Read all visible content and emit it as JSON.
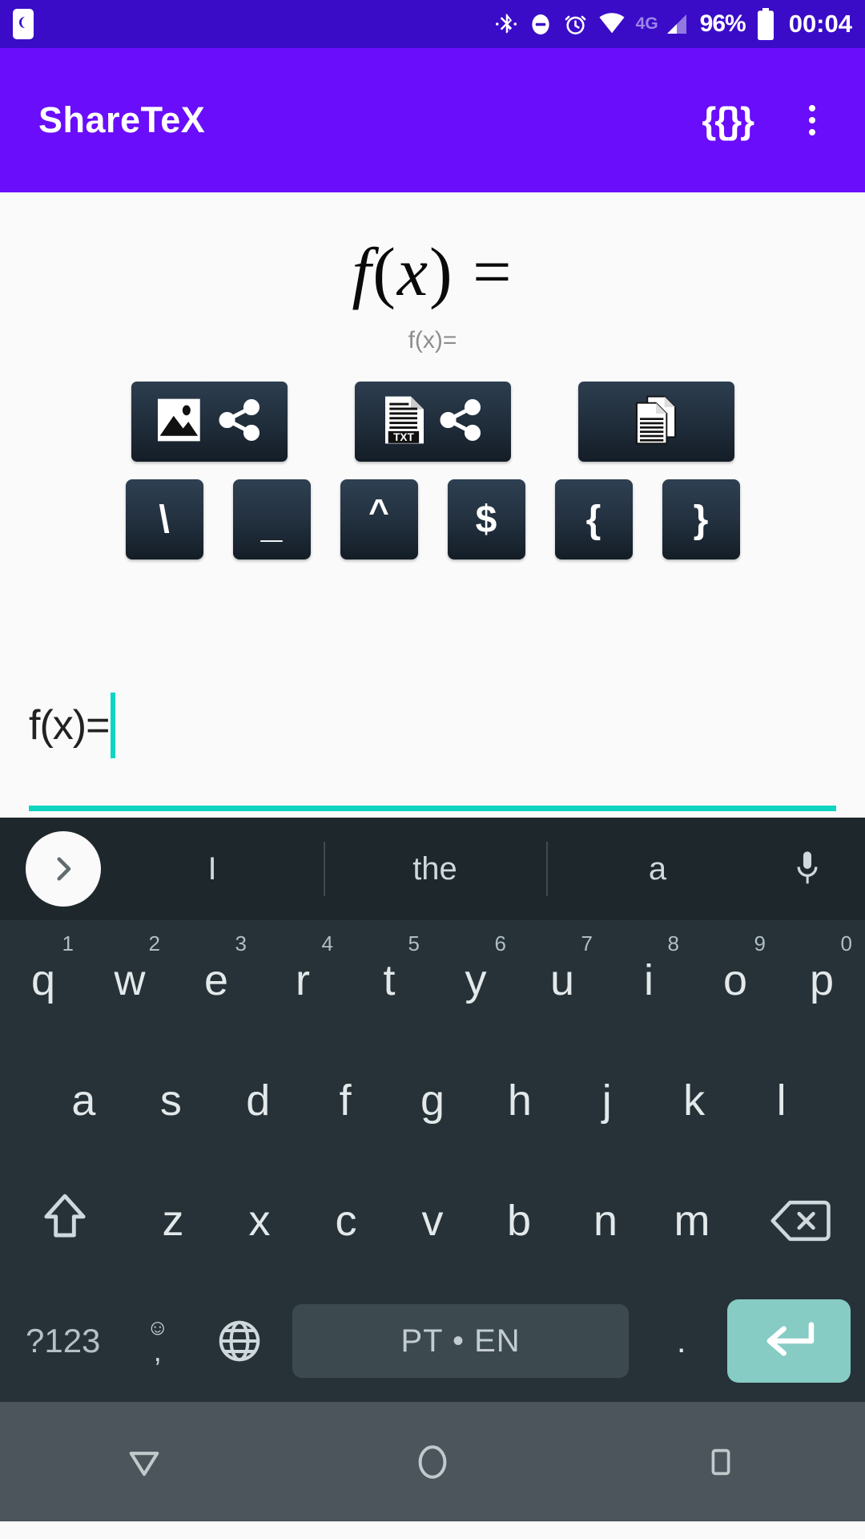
{
  "status_bar": {
    "left_icons": [
      "sim-card-icon"
    ],
    "right_icons": [
      "bluetooth-icon",
      "do-not-disturb-icon",
      "alarm-icon",
      "wifi-icon"
    ],
    "network_label": "4G",
    "battery_percent": "96%",
    "clock": "00:04",
    "background_color": "#3a0cc8"
  },
  "app_bar": {
    "title": "ShareTeX",
    "braces_action": "{{}}",
    "overflow_icon": "more-vertical-icon",
    "background_color": "#6a0dfa"
  },
  "preview": {
    "rendered_parts": {
      "f": "f",
      "open": "(",
      "x": "x",
      "close": ")",
      "equals": "="
    },
    "rendered_latex": "f(x) =",
    "source_text": "f(x)="
  },
  "action_buttons": [
    {
      "name": "share-image-button",
      "icon": "image-share-icon",
      "label": "Share image"
    },
    {
      "name": "share-txt-button",
      "icon": "txt-share-icon",
      "label": "Share TXT"
    },
    {
      "name": "copy-document-button",
      "icon": "copy-documents-icon",
      "label": "Copy"
    }
  ],
  "symbol_keys": [
    {
      "name": "key-backslash",
      "label": "\\"
    },
    {
      "name": "key-underscore",
      "label": "_"
    },
    {
      "name": "key-caret",
      "label": "^"
    },
    {
      "name": "key-dollar",
      "label": "$"
    },
    {
      "name": "key-brace-open",
      "label": "{"
    },
    {
      "name": "key-brace-close",
      "label": "}"
    }
  ],
  "editor": {
    "value": "f(x)=",
    "placeholder": "",
    "accent_color": "#0ed5c1"
  },
  "keyboard": {
    "suggestions": [
      "I",
      "the",
      "a"
    ],
    "expand_icon": "chevron-right-icon",
    "mic_icon": "microphone-icon",
    "row1": [
      {
        "key": "q",
        "hint": "1"
      },
      {
        "key": "w",
        "hint": "2"
      },
      {
        "key": "e",
        "hint": "3"
      },
      {
        "key": "r",
        "hint": "4"
      },
      {
        "key": "t",
        "hint": "5"
      },
      {
        "key": "y",
        "hint": "6"
      },
      {
        "key": "u",
        "hint": "7"
      },
      {
        "key": "i",
        "hint": "8"
      },
      {
        "key": "o",
        "hint": "9"
      },
      {
        "key": "p",
        "hint": "0"
      }
    ],
    "row2": [
      "a",
      "s",
      "d",
      "f",
      "g",
      "h",
      "j",
      "k",
      "l"
    ],
    "row3": [
      "z",
      "x",
      "c",
      "v",
      "b",
      "n",
      "m"
    ],
    "shift_icon": "shift-arrow-icon",
    "backspace_icon": "backspace-icon",
    "symbols_key": "?123",
    "emoji_key": "☺",
    "comma_key": ",",
    "globe_icon": "globe-language-icon",
    "space_label": "PT • EN",
    "period_key": ".",
    "enter_icon": "enter-return-icon",
    "background_color": "#263238",
    "enter_color": "#86cbc4"
  },
  "nav_bar": {
    "back_icon": "back-triangle-icon",
    "home_icon": "home-circle-icon",
    "recents_icon": "recents-square-icon"
  }
}
